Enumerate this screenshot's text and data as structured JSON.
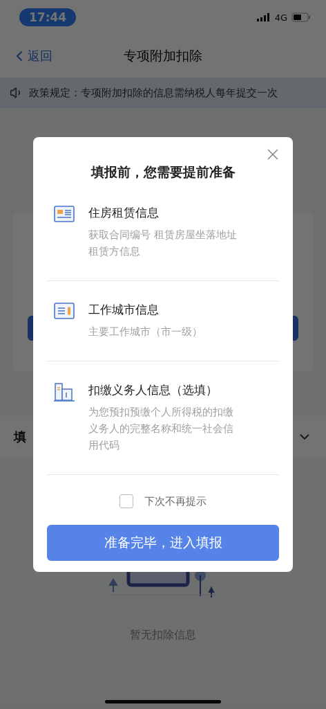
{
  "status_bar": {
    "time": "17:44",
    "network": "4G"
  },
  "nav": {
    "back": "返回",
    "title": "专项附加扣除"
  },
  "notice": "政策规定：专项附加扣除的信息需纳税人每年提交一次",
  "section": {
    "label": "填",
    "expanded": true
  },
  "empty": {
    "text": "暂无扣除信息"
  },
  "dialog": {
    "title": "填报前，您需要提前准备",
    "items": [
      {
        "kind": "rent",
        "title": "住房租赁信息",
        "description": "获取合同编号 租赁房屋坐落地址租赁方信息"
      },
      {
        "kind": "city",
        "title": "工作城市信息",
        "description": "主要工作城市（市一级）"
      },
      {
        "kind": "employer",
        "title": "扣缴义务人信息（选填）",
        "description": "为您预扣预缴个人所得税的扣缴义务人的完整名称和统一社会信用代码"
      }
    ],
    "checkbox": {
      "label": "下次不再提示",
      "checked": false
    },
    "confirm": "准备完毕，进入填报"
  }
}
